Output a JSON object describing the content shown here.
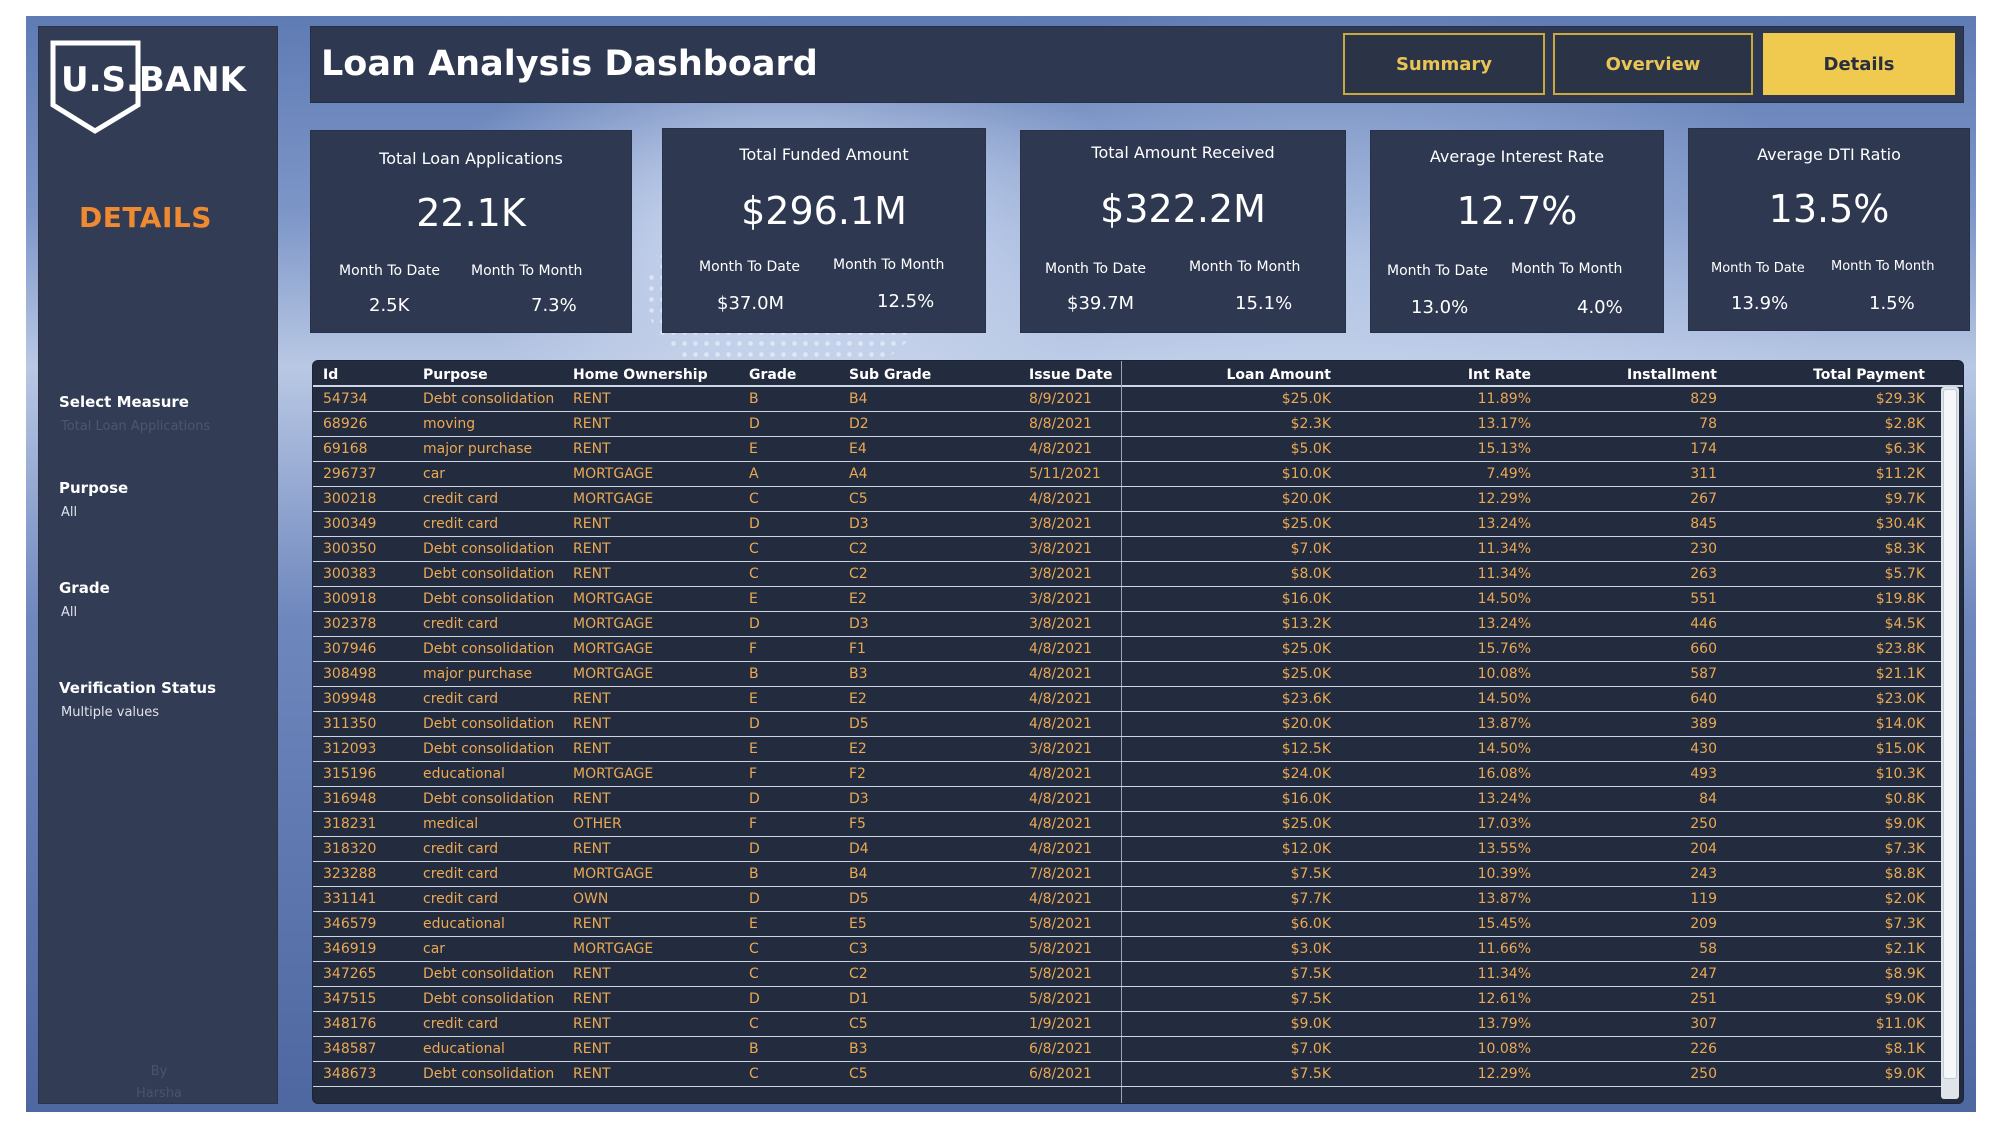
{
  "brand": {
    "logo_text": "U.S.BANK"
  },
  "sidebar": {
    "section_title": "DETAILS",
    "filters": [
      {
        "label": "Select Measure",
        "value": "Total Loan Applications"
      },
      {
        "label": "Purpose",
        "value": "All"
      },
      {
        "label": "Grade",
        "value": "All"
      },
      {
        "label": "Verification Status",
        "value": "Multiple values"
      }
    ],
    "byline_1": "By",
    "byline_2": "Harsha"
  },
  "header": {
    "title": "Loan Analysis Dashboard",
    "nav": [
      {
        "label": "Summary",
        "active": false
      },
      {
        "label": "Overview",
        "active": false
      },
      {
        "label": "Details",
        "active": true
      }
    ]
  },
  "kpis": [
    {
      "title": "Total Loan Applications",
      "value": "22.1K",
      "mtd_label": "Month To Date",
      "mom_label": "Month To Month",
      "mtd": "2.5K",
      "mom": "7.3%"
    },
    {
      "title": "Total Funded Amount",
      "value": "$296.1M",
      "mtd_label": "Month To Date",
      "mom_label": "Month To Month",
      "mtd": "$37.0M",
      "mom": "12.5%"
    },
    {
      "title": "Total Amount Received",
      "value": "$322.2M",
      "mtd_label": "Month To Date",
      "mom_label": "Month To Month",
      "mtd": "$39.7M",
      "mom": "15.1%"
    },
    {
      "title": "Average Interest Rate",
      "value": "12.7%",
      "mtd_label": "Month To Date",
      "mom_label": "Month To Month",
      "mtd": "13.0%",
      "mom": "4.0%"
    },
    {
      "title": "Average DTI Ratio",
      "value": "13.5%",
      "mtd_label": "Month To Date",
      "mom_label": "Month To Month",
      "mtd": "13.9%",
      "mom": "1.5%"
    }
  ],
  "table": {
    "columns": [
      "Id",
      "Purpose",
      "Home Ownership",
      "Grade",
      "Sub Grade",
      "Issue Date",
      "Loan Amount",
      "Int Rate",
      "Installment",
      "Total Payment"
    ],
    "rows": [
      [
        "54734",
        "Debt consolidation",
        "RENT",
        "B",
        "B4",
        "8/9/2021",
        "$25.0K",
        "11.89%",
        "829",
        "$29.3K"
      ],
      [
        "68926",
        "moving",
        "RENT",
        "D",
        "D2",
        "8/8/2021",
        "$2.3K",
        "13.17%",
        "78",
        "$2.8K"
      ],
      [
        "69168",
        "major purchase",
        "RENT",
        "E",
        "E4",
        "4/8/2021",
        "$5.0K",
        "15.13%",
        "174",
        "$6.3K"
      ],
      [
        "296737",
        "car",
        "MORTGAGE",
        "A",
        "A4",
        "5/11/2021",
        "$10.0K",
        "7.49%",
        "311",
        "$11.2K"
      ],
      [
        "300218",
        "credit card",
        "MORTGAGE",
        "C",
        "C5",
        "4/8/2021",
        "$20.0K",
        "12.29%",
        "267",
        "$9.7K"
      ],
      [
        "300349",
        "credit card",
        "RENT",
        "D",
        "D3",
        "3/8/2021",
        "$25.0K",
        "13.24%",
        "845",
        "$30.4K"
      ],
      [
        "300350",
        "Debt consolidation",
        "RENT",
        "C",
        "C2",
        "3/8/2021",
        "$7.0K",
        "11.34%",
        "230",
        "$8.3K"
      ],
      [
        "300383",
        "Debt consolidation",
        "RENT",
        "C",
        "C2",
        "3/8/2021",
        "$8.0K",
        "11.34%",
        "263",
        "$5.7K"
      ],
      [
        "300918",
        "Debt consolidation",
        "MORTGAGE",
        "E",
        "E2",
        "3/8/2021",
        "$16.0K",
        "14.50%",
        "551",
        "$19.8K"
      ],
      [
        "302378",
        "credit card",
        "MORTGAGE",
        "D",
        "D3",
        "3/8/2021",
        "$13.2K",
        "13.24%",
        "446",
        "$4.5K"
      ],
      [
        "307946",
        "Debt consolidation",
        "MORTGAGE",
        "F",
        "F1",
        "4/8/2021",
        "$25.0K",
        "15.76%",
        "660",
        "$23.8K"
      ],
      [
        "308498",
        "major purchase",
        "MORTGAGE",
        "B",
        "B3",
        "4/8/2021",
        "$25.0K",
        "10.08%",
        "587",
        "$21.1K"
      ],
      [
        "309948",
        "credit card",
        "RENT",
        "E",
        "E2",
        "4/8/2021",
        "$23.6K",
        "14.50%",
        "640",
        "$23.0K"
      ],
      [
        "311350",
        "Debt consolidation",
        "RENT",
        "D",
        "D5",
        "4/8/2021",
        "$20.0K",
        "13.87%",
        "389",
        "$14.0K"
      ],
      [
        "312093",
        "Debt consolidation",
        "RENT",
        "E",
        "E2",
        "3/8/2021",
        "$12.5K",
        "14.50%",
        "430",
        "$15.0K"
      ],
      [
        "315196",
        "educational",
        "MORTGAGE",
        "F",
        "F2",
        "4/8/2021",
        "$24.0K",
        "16.08%",
        "493",
        "$10.3K"
      ],
      [
        "316948",
        "Debt consolidation",
        "RENT",
        "D",
        "D3",
        "4/8/2021",
        "$16.0K",
        "13.24%",
        "84",
        "$0.8K"
      ],
      [
        "318231",
        "medical",
        "OTHER",
        "F",
        "F5",
        "4/8/2021",
        "$25.0K",
        "17.03%",
        "250",
        "$9.0K"
      ],
      [
        "318320",
        "credit card",
        "RENT",
        "D",
        "D4",
        "4/8/2021",
        "$12.0K",
        "13.55%",
        "204",
        "$7.3K"
      ],
      [
        "323288",
        "credit card",
        "MORTGAGE",
        "B",
        "B4",
        "7/8/2021",
        "$7.5K",
        "10.39%",
        "243",
        "$8.8K"
      ],
      [
        "331141",
        "credit card",
        "OWN",
        "D",
        "D5",
        "4/8/2021",
        "$7.7K",
        "13.87%",
        "119",
        "$2.0K"
      ],
      [
        "346579",
        "educational",
        "RENT",
        "E",
        "E5",
        "5/8/2021",
        "$6.0K",
        "15.45%",
        "209",
        "$7.3K"
      ],
      [
        "346919",
        "car",
        "MORTGAGE",
        "C",
        "C3",
        "5/8/2021",
        "$3.0K",
        "11.66%",
        "58",
        "$2.1K"
      ],
      [
        "347265",
        "Debt consolidation",
        "RENT",
        "C",
        "C2",
        "5/8/2021",
        "$7.5K",
        "11.34%",
        "247",
        "$8.9K"
      ],
      [
        "347515",
        "Debt consolidation",
        "RENT",
        "D",
        "D1",
        "5/8/2021",
        "$7.5K",
        "12.61%",
        "251",
        "$9.0K"
      ],
      [
        "348176",
        "credit card",
        "RENT",
        "C",
        "C5",
        "1/9/2021",
        "$9.0K",
        "13.79%",
        "307",
        "$11.0K"
      ],
      [
        "348587",
        "educational",
        "RENT",
        "B",
        "B3",
        "6/8/2021",
        "$7.0K",
        "10.08%",
        "226",
        "$8.1K"
      ],
      [
        "348673",
        "Debt consolidation",
        "RENT",
        "C",
        "C5",
        "6/8/2021",
        "$7.5K",
        "12.29%",
        "250",
        "$9.0K"
      ]
    ]
  },
  "colors": {
    "accent_orange": "#f08a32",
    "nav_gold": "#f0c94f",
    "panel": "#2e3850",
    "row_text": "#e9a955"
  }
}
